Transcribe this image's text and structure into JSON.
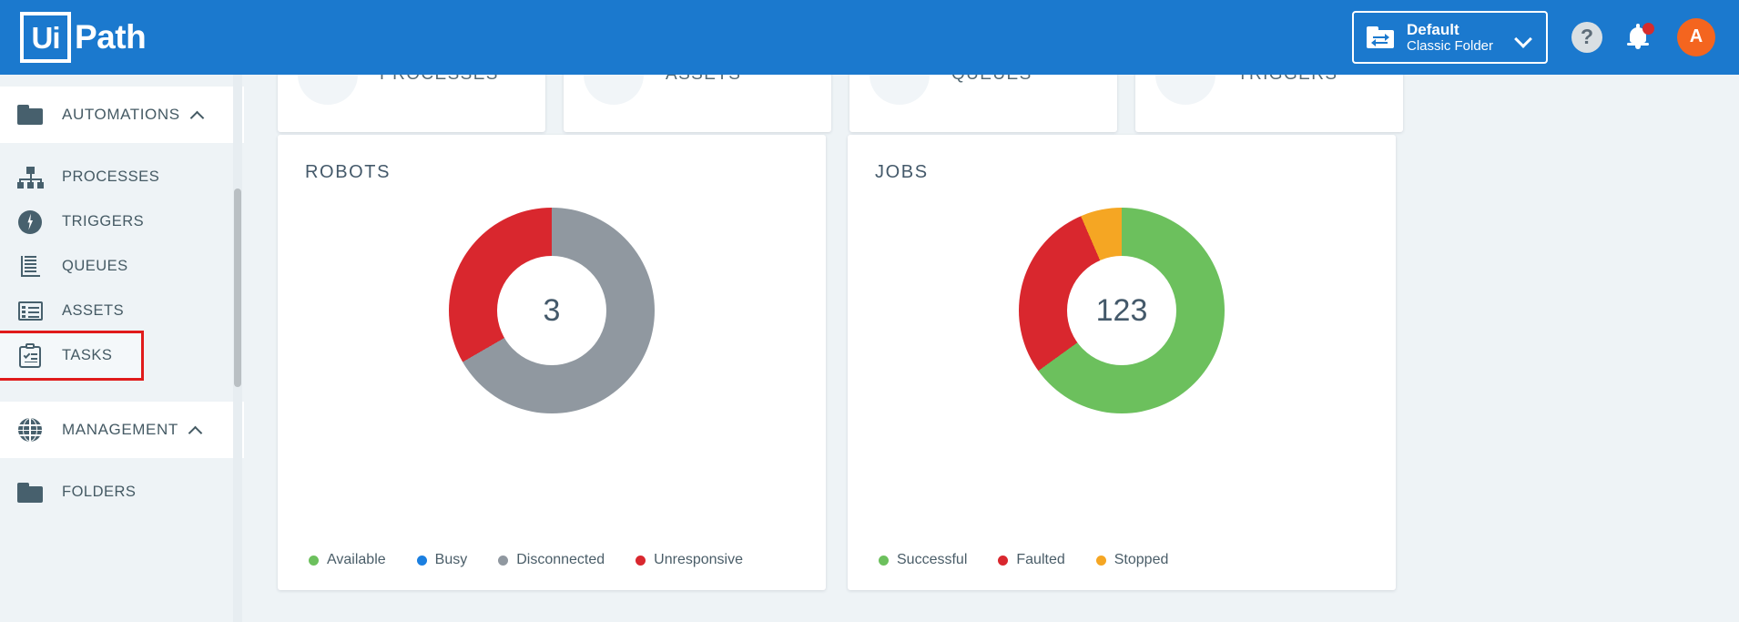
{
  "header": {
    "logo_mark": "Ui",
    "logo_text": "Path",
    "folder_switcher": {
      "title": "Default",
      "subtitle": "Classic Folder",
      "folder_icon": "folder-switch-icon",
      "chevron_icon": "chevron-down-icon"
    },
    "help_label": "?",
    "help_icon": "help-circle-icon",
    "notification_icon": "bell-icon",
    "notification_badge": "",
    "avatar_initial": "A",
    "brand_color": "#1b79ce",
    "avatar_color": "#f4651f"
  },
  "sidebar": {
    "sections": [
      {
        "label": "AUTOMATIONS",
        "icon": "folder-icon",
        "chevron": "chevron-up-icon",
        "expanded": true,
        "items": [
          {
            "label": "PROCESSES",
            "icon": "process-chart-icon",
            "highlighted": false
          },
          {
            "label": "TRIGGERS",
            "icon": "lightning-bolt-icon",
            "highlighted": false
          },
          {
            "label": "QUEUES",
            "icon": "queue-stack-icon",
            "highlighted": false
          },
          {
            "label": "ASSETS",
            "icon": "asset-list-icon",
            "highlighted": false
          },
          {
            "label": "TASKS",
            "icon": "task-clipboard-icon",
            "highlighted": true
          }
        ]
      },
      {
        "label": "MANAGEMENT",
        "icon": "globe-icon",
        "chevron": "chevron-up-icon",
        "expanded": true,
        "items": [
          {
            "label": "FOLDERS",
            "icon": "folder-icon",
            "highlighted": false
          }
        ]
      }
    ],
    "highlight_color": "#e01b1b",
    "scrollbar": "vertical-scrollbar"
  },
  "main": {
    "kpi_cards": [
      {
        "label": "PROCESSES"
      },
      {
        "label": "ASSETS"
      },
      {
        "label": "QUEUES"
      },
      {
        "label": "TRIGGERS"
      }
    ],
    "charts": [
      {
        "title": "ROBOTS",
        "center_value": "3",
        "legend": [
          {
            "label": "Available",
            "color": "#6cc05d"
          },
          {
            "label": "Busy",
            "color": "#1b7fe0"
          },
          {
            "label": "Disconnected",
            "color": "#9098a0"
          },
          {
            "label": "Unresponsive",
            "color": "#d9272e"
          }
        ]
      },
      {
        "title": "JOBS",
        "center_value": "123",
        "legend": [
          {
            "label": "Successful",
            "color": "#6cc05d"
          },
          {
            "label": "Faulted",
            "color": "#d9272e"
          },
          {
            "label": "Stopped",
            "color": "#f5a623"
          }
        ]
      }
    ]
  },
  "chart_data": [
    {
      "type": "pie",
      "title": "ROBOTS",
      "variant": "donut",
      "center_label": "3",
      "total": 3,
      "labels": [
        "Available",
        "Busy",
        "Disconnected",
        "Unresponsive"
      ],
      "values": [
        0,
        0,
        2,
        1
      ],
      "percentages": [
        0,
        0,
        66.7,
        33.3
      ],
      "colors": [
        "#6cc05d",
        "#1b7fe0",
        "#9098a0",
        "#d9272e"
      ],
      "legend_position": "bottom-left",
      "grid": false,
      "start_angle_deg": 0,
      "notes": "Red (Unresponsive) wedge spans from 12 o'clock counter-clockwise to about 7:30; remaining arc is gray (Disconnected). Available and Busy have no visible slice."
    },
    {
      "type": "pie",
      "title": "JOBS",
      "variant": "donut",
      "center_label": "123",
      "total": 123,
      "labels": [
        "Successful",
        "Faulted",
        "Stopped"
      ],
      "values": [
        80,
        35,
        8
      ],
      "percentages": [
        65,
        28.5,
        6.5
      ],
      "colors": [
        "#6cc05d",
        "#d9272e",
        "#f5a623"
      ],
      "legend_position": "bottom-left",
      "grid": false,
      "start_angle_deg": 0,
      "notes": "Green (Successful) from 12 o'clock clockwise to about 7:45; red (Faulted) continues to about 11:20; small orange (Stopped) wedge closes the circle back to 12."
    }
  ]
}
